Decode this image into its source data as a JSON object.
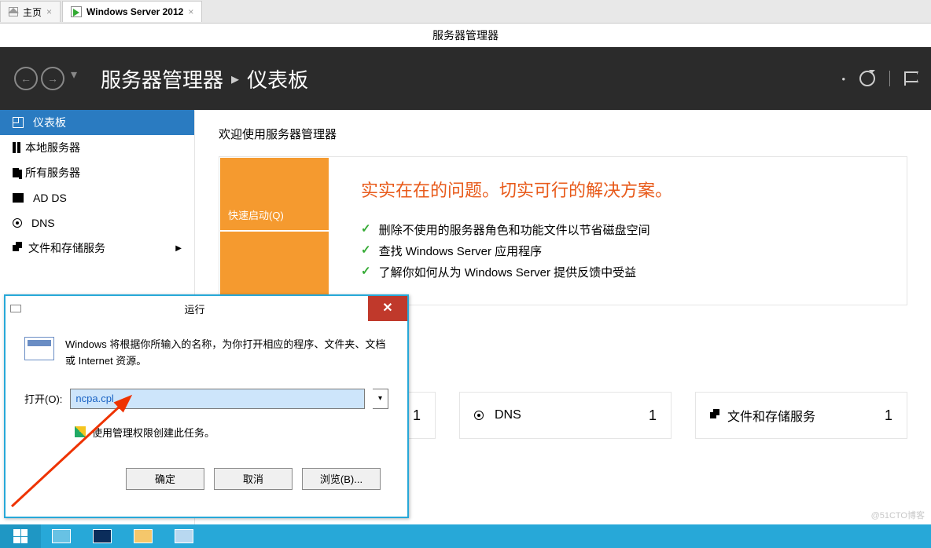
{
  "browser_tabs": {
    "home": "主页",
    "current": "Windows Server 2012"
  },
  "titlebar": "服务器管理器",
  "breadcrumb": {
    "part1": "服务器管理器",
    "part2": "仪表板"
  },
  "sidebar": {
    "items": [
      {
        "label": "仪表板"
      },
      {
        "label": "本地服务器"
      },
      {
        "label": "所有服务器"
      },
      {
        "label": "AD DS"
      },
      {
        "label": "DNS"
      },
      {
        "label": "文件和存储服务"
      }
    ]
  },
  "welcome": "欢迎使用服务器管理器",
  "quickstart": "快速启动(Q)",
  "headline": "实实在在的问题。切实可行的解决方案。",
  "bullets": [
    "删除不使用的服务器角色和功能文件以节省磁盘空间",
    "查找 Windows Server 应用程序",
    "了解你如何从为 Windows Server 提供反馈中受益"
  ],
  "tiles": {
    "dns": {
      "label": "DNS",
      "count": "1"
    },
    "files": {
      "label": "文件和存储服务",
      "count": "1"
    },
    "extra": "1"
  },
  "run": {
    "title": "运行",
    "desc": "Windows 将根据你所输入的名称，为你打开相应的程序、文件夹、文档或 Internet 资源。",
    "open_label": "打开(O):",
    "value": "ncpa.cpl",
    "admin_note": "使用管理权限创建此任务。",
    "ok": "确定",
    "cancel": "取消",
    "browse": "浏览(B)..."
  },
  "watermark": "@51CTO博客"
}
